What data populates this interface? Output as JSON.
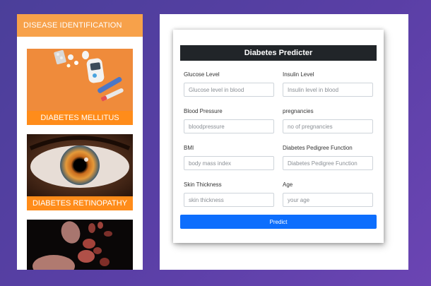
{
  "sidebar": {
    "title": "DISEASE IDENTIFICATION",
    "cards": [
      {
        "label": "DIABETES MELLITUS",
        "icon": "glucometer-pills-image"
      },
      {
        "label": "DIABETES RETINOPATHY",
        "icon": "eye-iris-image"
      },
      {
        "label": "",
        "icon": "blood-cells-image"
      }
    ]
  },
  "form": {
    "title": "Diabetes Predicter",
    "fields": [
      {
        "label": "Glucose Level",
        "placeholder": "Glucose level in blood"
      },
      {
        "label": "Insulin Level",
        "placeholder": "Insulin level in blood"
      },
      {
        "label": "Blood Pressure",
        "placeholder": "bloodpressure"
      },
      {
        "label": "pregnancies",
        "placeholder": "no of pregnancies"
      },
      {
        "label": "BMI",
        "placeholder": "body mass index"
      },
      {
        "label": "Diabetes Pedigree Function",
        "placeholder": "Diabetes Pedigree Function"
      },
      {
        "label": "Skin Thickness",
        "placeholder": "skin thickness"
      },
      {
        "label": "Age",
        "placeholder": "your age"
      }
    ],
    "submit_label": "Predict"
  },
  "colors": {
    "header_orange": "#f7a14a",
    "card_label_orange": "#ff8c1a",
    "title_bar": "#212529",
    "primary_button": "#0d6efd"
  }
}
